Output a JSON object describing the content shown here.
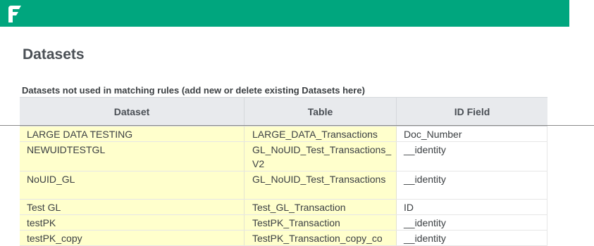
{
  "header": {
    "logo_name": "brand-logo",
    "brand_color": "#00a67e"
  },
  "page": {
    "title": "Datasets",
    "section_label": "Datasets not used in matching rules (add new or delete existing Datasets here)"
  },
  "table": {
    "columns": [
      "Dataset",
      "Table",
      "ID Field"
    ],
    "rows": [
      {
        "dataset": "LARGE DATA TESTING",
        "table": "LARGE_DATA_Transactions",
        "id_field": "Doc_Number"
      },
      {
        "dataset": "NEWUIDTESTGL",
        "table": "GL_NoUID_Test_Transactions_V2",
        "id_field": "__identity"
      },
      {
        "dataset": "NoUID_GL",
        "table": "GL_NoUID_Test_Transactions",
        "id_field": "__identity"
      },
      {
        "dataset": "Test GL",
        "table": "Test_GL_Transaction",
        "id_field": "ID"
      },
      {
        "dataset": "testPK",
        "table": "TestPK_Transaction",
        "id_field": "__identity"
      },
      {
        "dataset": "testPK_copy",
        "table": "TestPK_Transaction_copy_co",
        "id_field": "__identity"
      }
    ],
    "editable_color": "#ffffcc"
  }
}
